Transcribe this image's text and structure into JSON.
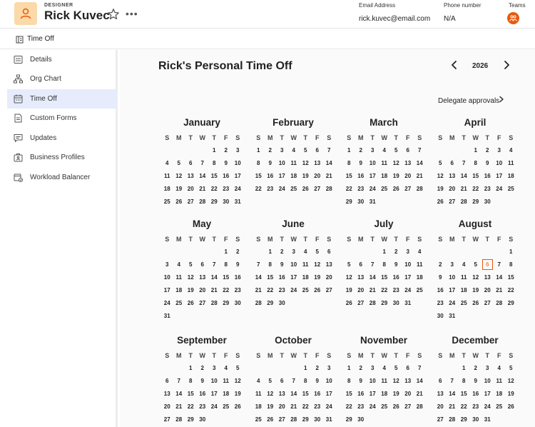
{
  "profile": {
    "role": "DESIGNER",
    "name": "Rick Kuvec",
    "email_label": "Email Address",
    "email": "rick.kuvec@email.com",
    "phone_label": "Phone number",
    "phone": "N/A",
    "teams_label": "Teams"
  },
  "subbar": {
    "title": "Time Off"
  },
  "sidebar": {
    "items": [
      {
        "label": "Details",
        "icon": "details-icon"
      },
      {
        "label": "Org Chart",
        "icon": "org-chart-icon"
      },
      {
        "label": "Time Off",
        "icon": "calendar-icon",
        "active": true
      },
      {
        "label": "Custom Forms",
        "icon": "form-icon"
      },
      {
        "label": "Updates",
        "icon": "chat-icon"
      },
      {
        "label": "Business Profiles",
        "icon": "business-profile-icon"
      },
      {
        "label": "Workload Balancer",
        "icon": "workload-icon"
      }
    ]
  },
  "main": {
    "title": "Rick's Personal Time Off",
    "year": "2026",
    "delegate": "Delegate approvals"
  },
  "calendar": {
    "weekdays": [
      "S",
      "M",
      "T",
      "W",
      "T",
      "F",
      "S"
    ],
    "today": {
      "month": 7,
      "day": 6
    },
    "accent": "#e8590c",
    "months": [
      {
        "name": "January",
        "start": 4,
        "days": 31
      },
      {
        "name": "February",
        "start": 0,
        "days": 28
      },
      {
        "name": "March",
        "start": 0,
        "days": 31
      },
      {
        "name": "April",
        "start": 3,
        "days": 30
      },
      {
        "name": "May",
        "start": 5,
        "days": 31
      },
      {
        "name": "June",
        "start": 1,
        "days": 30
      },
      {
        "name": "July",
        "start": 3,
        "days": 31
      },
      {
        "name": "August",
        "start": 6,
        "days": 31
      },
      {
        "name": "September",
        "start": 2,
        "days": 30
      },
      {
        "name": "October",
        "start": 4,
        "days": 31
      },
      {
        "name": "November",
        "start": 0,
        "days": 30
      },
      {
        "name": "December",
        "start": 2,
        "days": 31
      }
    ]
  }
}
